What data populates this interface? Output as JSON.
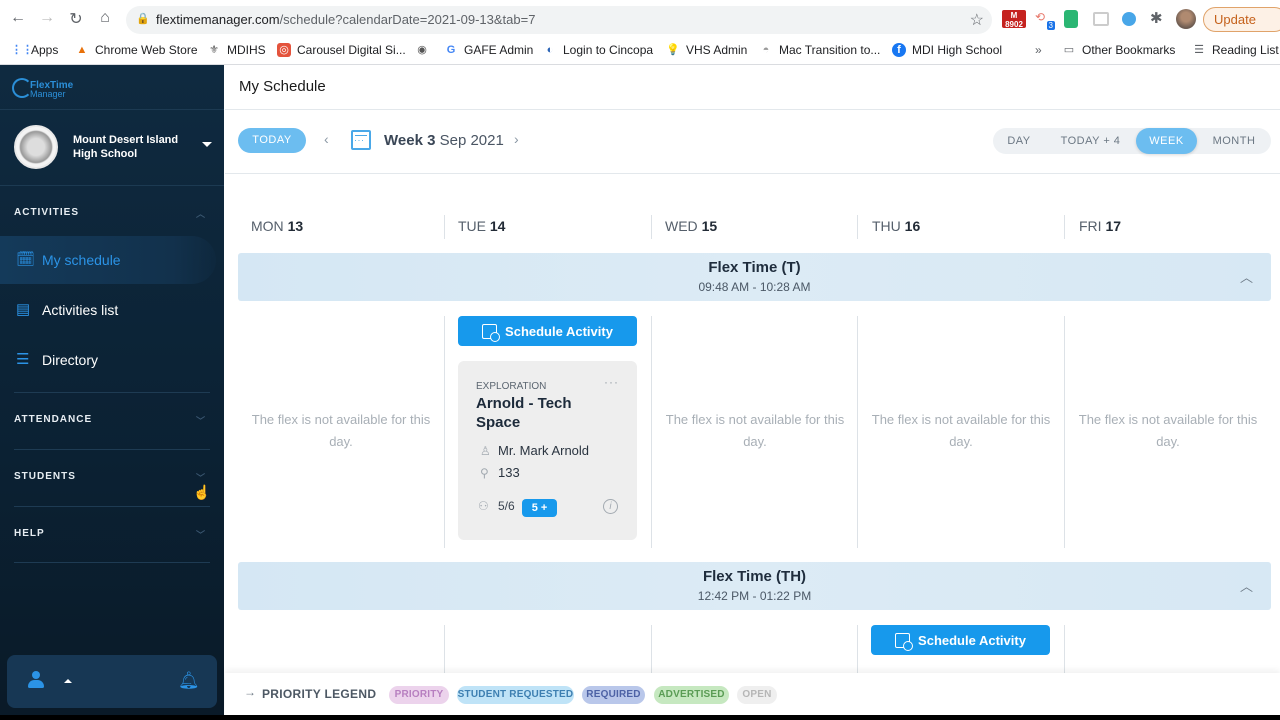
{
  "browser": {
    "url_host": "flextimemanager.com",
    "url_path": "/schedule?calendarDate=2021-09-13&tab=7",
    "gmail_badge": "8902",
    "ext_badge": "3",
    "update_label": "Update",
    "bookmarks": [
      {
        "label": "Apps",
        "icon": "apps-grid-icon"
      },
      {
        "label": "Chrome Web Store",
        "icon": "chrome-web-store-icon"
      },
      {
        "label": "MDIHS",
        "icon": "mdihs-icon"
      },
      {
        "label": "Carousel Digital Si...",
        "icon": "carousel-icon"
      },
      {
        "label": "",
        "icon": "globe-icon"
      },
      {
        "label": "GAFE Admin",
        "icon": "google-icon"
      },
      {
        "label": "Login to Cincopa",
        "icon": "cincopa-icon"
      },
      {
        "label": "VHS Admin",
        "icon": "lightbulb-icon"
      },
      {
        "label": "Mac Transition to...",
        "icon": "mac-icon"
      },
      {
        "label": "MDI High School",
        "icon": "facebook-icon"
      }
    ],
    "overflow_label": "»",
    "other_bookmarks": "Other Bookmarks",
    "reading_list": "Reading List"
  },
  "sidebar": {
    "logo_line1": "FlexTime",
    "logo_line2": "Manager",
    "school_name": "Mount Desert Island High School",
    "sections": [
      {
        "label": "ACTIVITIES",
        "expanded": true
      },
      {
        "label": "ATTENDANCE",
        "expanded": false
      },
      {
        "label": "STUDENTS",
        "expanded": false
      },
      {
        "label": "HELP",
        "expanded": false
      }
    ],
    "items": [
      {
        "label": "My schedule",
        "icon": "calendar-clock-icon",
        "active": true
      },
      {
        "label": "Activities list",
        "icon": "list-card-icon",
        "active": false
      },
      {
        "label": "Directory",
        "icon": "directory-list-icon",
        "active": false
      }
    ]
  },
  "main": {
    "page_title": "My Schedule",
    "today_label": "TODAY",
    "week_bold": "Week 3",
    "week_rest": " Sep 2021",
    "views": [
      {
        "label": "DAY",
        "active": false
      },
      {
        "label": "TODAY + 4",
        "active": false
      },
      {
        "label": "WEEK",
        "active": true
      },
      {
        "label": "MONTH",
        "active": false
      }
    ],
    "days": [
      {
        "dow": "MON",
        "num": "13"
      },
      {
        "dow": "TUE",
        "num": "14"
      },
      {
        "dow": "WED",
        "num": "15"
      },
      {
        "dow": "THU",
        "num": "16"
      },
      {
        "dow": "FRI",
        "num": "17"
      }
    ],
    "flex_blocks": [
      {
        "title": "Flex Time (T)",
        "time": "09:48 AM - 10:28 AM",
        "not_available_text": "The flex is not available for this day.",
        "schedule_button": "Schedule Activity",
        "activity": {
          "category": "EXPLORATION",
          "title": "Arnold - Tech Space",
          "teacher": "Mr. Mark Arnold",
          "room": "133",
          "seats": "5/6",
          "add_count": "5",
          "add_symbol": "+"
        }
      },
      {
        "title": "Flex Time (TH)",
        "time": "12:42 PM - 01:22 PM",
        "schedule_button": "Schedule Activity"
      }
    ],
    "legend": {
      "label": "PRIORITY LEGEND",
      "items": [
        {
          "label": "PRIORITY",
          "bg": "#ecd3ec",
          "fg": "#b77fc0"
        },
        {
          "label": "STUDENT REQUESTED",
          "bg": "#bfe3f7",
          "fg": "#3d7fb1"
        },
        {
          "label": "REQUIRED",
          "bg": "#b9c7ea",
          "fg": "#4d62a5"
        },
        {
          "label": "ADVERTISED",
          "bg": "#c6e8c0",
          "fg": "#5a9c54"
        },
        {
          "label": "OPEN",
          "bg": "#efefef",
          "fg": "#b6b6b6"
        }
      ]
    }
  }
}
